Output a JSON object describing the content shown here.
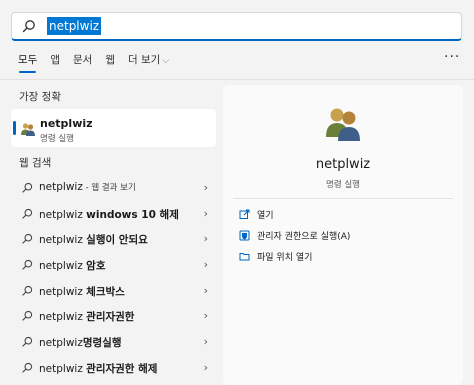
{
  "search": {
    "value": "netplwiz"
  },
  "tabs": [
    {
      "label": "모두",
      "active": true
    },
    {
      "label": "앱"
    },
    {
      "label": "문서"
    },
    {
      "label": "웹"
    },
    {
      "label": "더 보기"
    }
  ],
  "more_label": "···",
  "best_match": {
    "section_title": "가장 정확",
    "title": "netplwiz",
    "subtitle": "명령 실행",
    "icon": "users-icon"
  },
  "web_search": {
    "section_title": "웹 검색",
    "items": [
      {
        "query": "netplwiz",
        "extra": " - 웹 결과 보기"
      },
      {
        "query": "netplwiz ",
        "bold": "windows 10 해제"
      },
      {
        "query": "netplwiz ",
        "bold": "실행이 안되요"
      },
      {
        "query": "netplwiz ",
        "bold": "암호"
      },
      {
        "query": "netplwiz ",
        "bold": "체크박스"
      },
      {
        "query": "netplwiz ",
        "bold": "관리자권한"
      },
      {
        "query": "netplwiz",
        "bold": "명령실행"
      },
      {
        "query": "netplwiz ",
        "bold": "관리자권한 해제"
      }
    ]
  },
  "details": {
    "title": "netplwiz",
    "subtitle": "명령 실행",
    "actions": [
      {
        "label": "열기",
        "icon": "open-icon"
      },
      {
        "label": "관리자 권한으로 실행(A)",
        "icon": "shield-icon"
      },
      {
        "label": "파일 위치 열기",
        "icon": "folder-icon"
      }
    ]
  },
  "colors": {
    "accent": "#0067c0",
    "background": "#f3f3f3",
    "panel": "#fafafa"
  }
}
